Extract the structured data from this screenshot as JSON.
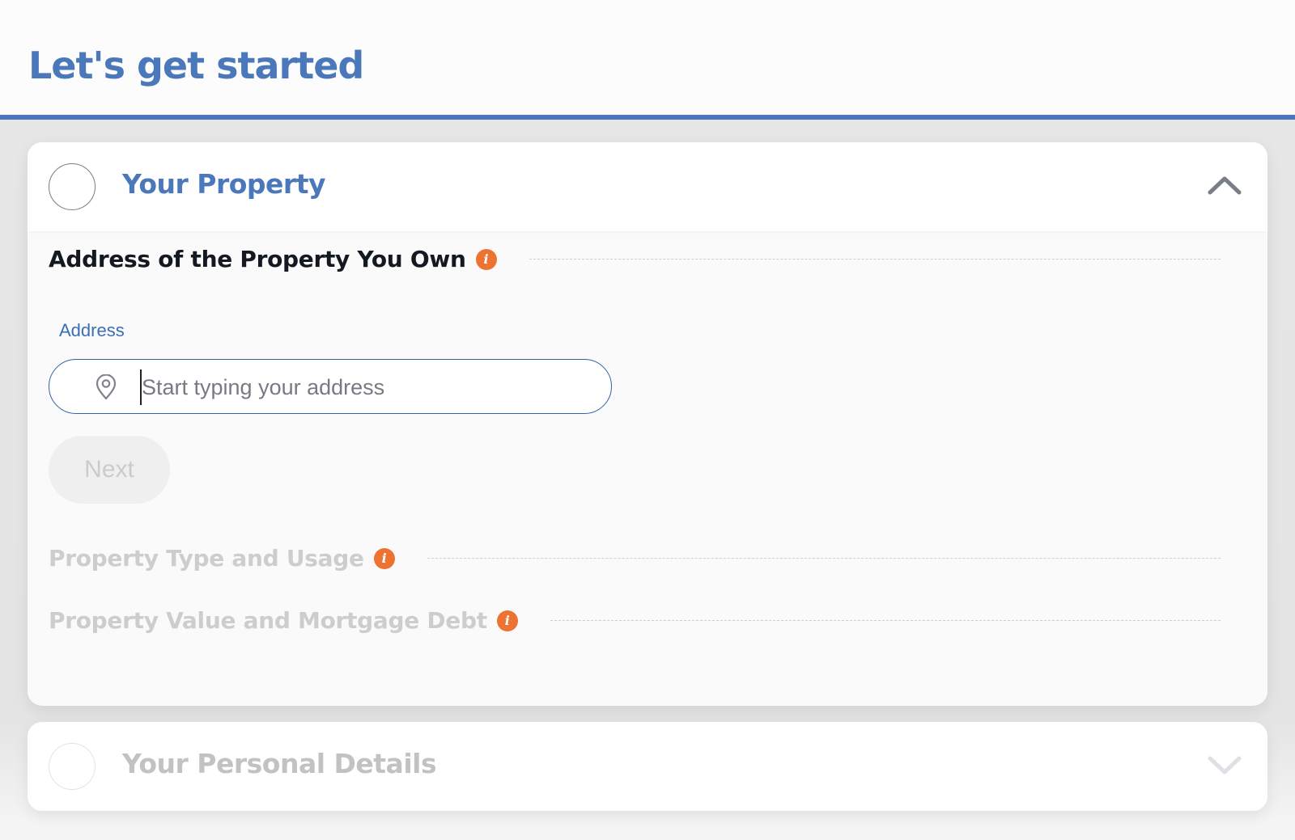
{
  "header": {
    "title": "Let's get started"
  },
  "steps": [
    {
      "title": "Your Property",
      "state": "expanded",
      "sections": [
        {
          "title": "Address of the Property You Own",
          "info_icon": "info-icon",
          "active": true,
          "field": {
            "label": "Address",
            "icon": "map-pin-icon",
            "value": "",
            "placeholder": "Start typing your address"
          },
          "next_label": "Next"
        },
        {
          "title": "Property Type and Usage",
          "info_icon": "info-icon",
          "active": false
        },
        {
          "title": "Property Value and Mortgage Debt",
          "info_icon": "info-icon",
          "active": false
        }
      ],
      "toggle_icon": "chevron-up-icon"
    },
    {
      "title": "Your Personal Details",
      "state": "collapsed",
      "toggle_icon": "chevron-down-icon"
    }
  ],
  "icons": {
    "info_glyph": "i"
  },
  "colors": {
    "brand_blue": "#4a78bb",
    "info_orange": "#ec7332",
    "disabled_text": "#cdcdcd"
  }
}
